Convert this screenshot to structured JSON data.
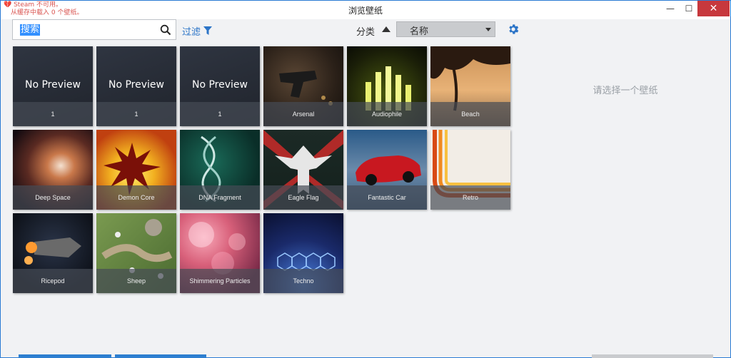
{
  "window": {
    "title": "浏览壁纸",
    "warning_line1": "Steam 不可用。",
    "warning_line2": "从缓存中载入 0 个壁纸。",
    "min_glyph": "—",
    "max_glyph": "☐",
    "close_glyph": "✕"
  },
  "toolbar": {
    "search_placeholder": "搜索",
    "search_value": "搜索",
    "filter_label": "过滤",
    "sort_label": "分类",
    "sort_value": "名称"
  },
  "wallpapers": [
    {
      "name": "1",
      "preview_text": "No Preview"
    },
    {
      "name": "1",
      "preview_text": "No Preview"
    },
    {
      "name": "1",
      "preview_text": "No Preview"
    },
    {
      "name": "Arsenal"
    },
    {
      "name": "Audiophile"
    },
    {
      "name": "Beach"
    },
    {
      "name": "Deep Space"
    },
    {
      "name": "Demon Core"
    },
    {
      "name": "DNA Fragment"
    },
    {
      "name": "Eagle Flag"
    },
    {
      "name": "Fantastic Car"
    },
    {
      "name": "Retro"
    },
    {
      "name": "Ricepod"
    },
    {
      "name": "Sheep"
    },
    {
      "name": "Shimmering Particles"
    },
    {
      "name": "Techno"
    }
  ],
  "details": {
    "empty_hint": "请选择一个壁纸"
  },
  "colors": {
    "accent": "#2b74c7",
    "close_button": "#c7383d"
  }
}
